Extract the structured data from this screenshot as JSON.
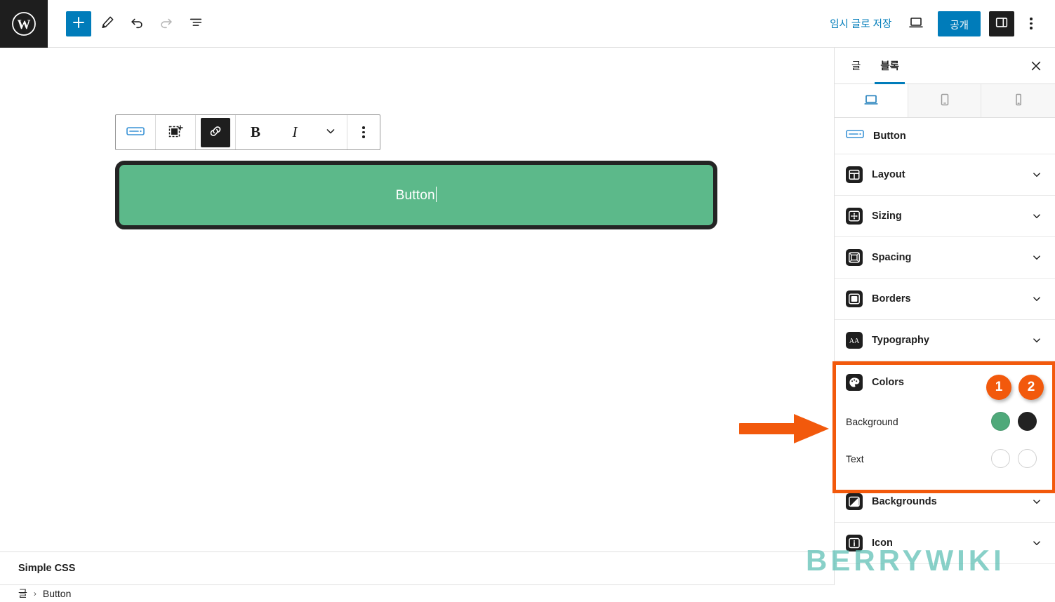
{
  "header": {
    "logo_icon": "wordpress-logo-icon",
    "add_block_label": "+",
    "add_block_icon": "plus-icon",
    "tools_icon": "pencil-edit-icon",
    "undo_icon": "undo-arrow-icon",
    "redo_icon": "redo-arrow-icon",
    "list_view_icon": "document-outline-icon",
    "save_draft_label": "임시 글로 저장",
    "preview_icon": "desktop-preview-icon",
    "publish_label": "공개",
    "settings_toggle_icon": "sidebar-panel-icon",
    "options_icon": "kebab-menu-icon"
  },
  "block_toolbar": {
    "block_type_icon": "button-block-icon",
    "move_icon": "drag-select-icon",
    "link_icon": "link-icon",
    "bold_label": "B",
    "italic_label": "I",
    "more_formats_icon": "chevron-down-icon",
    "options_icon": "kebab-menu-icon"
  },
  "canvas": {
    "button_block": {
      "label": "Button",
      "background_color": "#5cb98a",
      "border_color": "#242424",
      "text_color": "#ffffff"
    }
  },
  "sidebar": {
    "tabs": [
      {
        "label": "글",
        "active": false
      },
      {
        "label": "블록",
        "active": true
      }
    ],
    "close_icon": "close-x-icon",
    "device_tabs": [
      {
        "name": "desktop",
        "icon": "laptop-icon",
        "active": true
      },
      {
        "name": "tablet",
        "icon": "tablet-icon",
        "active": false
      },
      {
        "name": "mobile",
        "icon": "mobile-icon",
        "active": false
      }
    ],
    "block_name": "Button",
    "block_name_icon": "button-block-icon",
    "panels": [
      {
        "label": "Layout",
        "icon": "layout-icon"
      },
      {
        "label": "Sizing",
        "icon": "sizing-arrows-icon"
      },
      {
        "label": "Spacing",
        "icon": "spacing-icon"
      },
      {
        "label": "Borders",
        "icon": "borders-icon"
      },
      {
        "label": "Typography",
        "icon": "typography-aa-icon"
      }
    ],
    "colors_panel": {
      "label": "Colors",
      "icon": "color-palette-icon",
      "options": [
        {
          "label": "Background",
          "swatches": [
            {
              "color": "#4fa97a",
              "empty": false
            },
            {
              "color": "#222222",
              "empty": false
            }
          ]
        },
        {
          "label": "Text",
          "swatches": [
            {
              "color": "#ffffff",
              "empty": true
            },
            {
              "color": "#ffffff",
              "empty": true
            }
          ]
        }
      ]
    },
    "panels_after": [
      {
        "label": "Backgrounds",
        "icon": "background-image-icon"
      },
      {
        "label": "Icon",
        "icon": "info-icon"
      }
    ]
  },
  "annotations": {
    "badges": [
      {
        "number": "1"
      },
      {
        "number": "2"
      }
    ],
    "highlight_color": "#F2590C",
    "arrow_color": "#F2590C",
    "arrow_icon": "right-arrow-icon"
  },
  "footer": {
    "simple_css_label": "Simple CSS",
    "breadcrumb": [
      {
        "label": "글"
      },
      {
        "label": "Button"
      }
    ],
    "breadcrumb_separator": "›"
  },
  "watermark": {
    "text": "BERRYWIKI",
    "color": "#5BBFB4"
  }
}
